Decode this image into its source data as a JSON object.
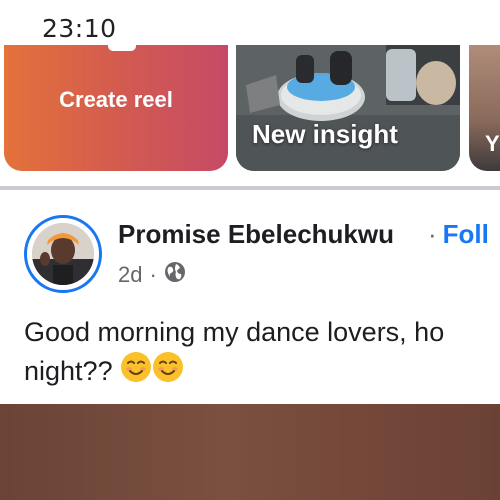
{
  "status_bar": {
    "time": "23:10"
  },
  "stories": {
    "create_reel": "Create reel",
    "insight_label": "New insight",
    "third_label": "Y"
  },
  "post": {
    "author": "Promise Ebelechukwu",
    "follow_separator": "·",
    "follow_label": "Foll",
    "age": "2d",
    "meta_separator": "·",
    "audience_icon": "globe-icon",
    "text_line1": "Good morning my dance lovers,  ho",
    "text_line2": "night??"
  },
  "colors": {
    "link_blue": "#1877f2",
    "secondary_text": "#65676b",
    "divider": "#c9ccd1"
  }
}
